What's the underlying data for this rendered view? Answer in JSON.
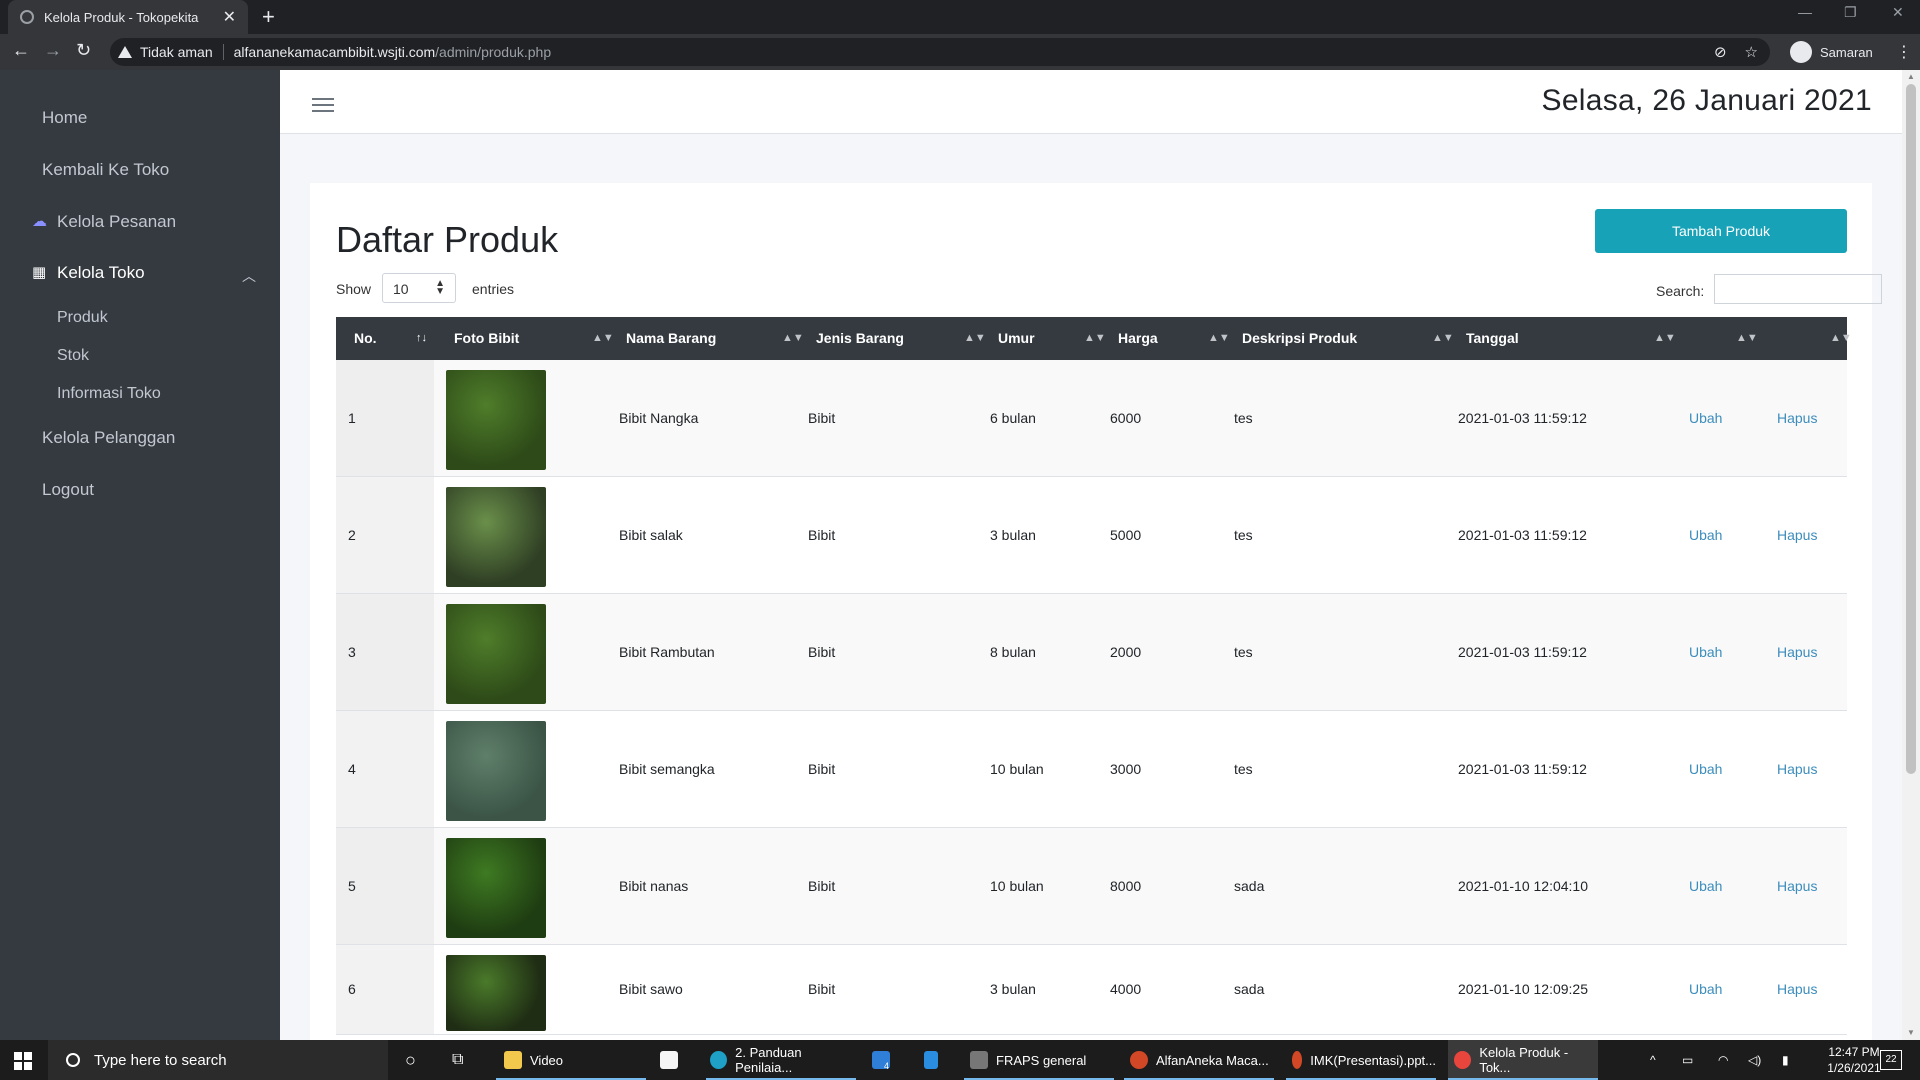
{
  "browser": {
    "tab_title": "Kelola Produk - Tokopekita",
    "security_label": "Tidak aman",
    "url_host": "alfananekamacambibit.wsjti.com",
    "url_path": "/admin/produk.php",
    "profile_name": "Samaran"
  },
  "sidebar": {
    "home": "Home",
    "back_to_store": "Kembali Ke Toko",
    "orders": "Kelola Pesanan",
    "manage_store": "Kelola Toko",
    "sub_items": [
      "Produk",
      "Stok",
      "Informasi Toko"
    ],
    "customers": "Kelola Pelanggan",
    "logout": "Logout"
  },
  "header": {
    "date": "Selasa, 26 Januari 2021"
  },
  "content": {
    "title": "Daftar Produk",
    "add_button": "Tambah Produk",
    "show_label": "Show",
    "entries_value": "10",
    "entries_label": "entries",
    "search_label": "Search:"
  },
  "table": {
    "columns": [
      "No.",
      "Foto Bibit",
      "Nama Barang",
      "Jenis Barang",
      "Umur",
      "Harga",
      "Deskripsi Produk",
      "Tanggal"
    ],
    "rows": [
      {
        "no": "1",
        "nama": "Bibit Nangka",
        "jenis": "Bibit",
        "umur": "6 bulan",
        "harga": "6000",
        "deskripsi": "tes",
        "tanggal": "2021-01-03 11:59:12",
        "edit": "Ubah",
        "delete": "Hapus"
      },
      {
        "no": "2",
        "nama": "Bibit salak",
        "jenis": "Bibit",
        "umur": "3 bulan",
        "harga": "5000",
        "deskripsi": "tes",
        "tanggal": "2021-01-03 11:59:12",
        "edit": "Ubah",
        "delete": "Hapus"
      },
      {
        "no": "3",
        "nama": "Bibit Rambutan",
        "jenis": "Bibit",
        "umur": "8 bulan",
        "harga": "2000",
        "deskripsi": "tes",
        "tanggal": "2021-01-03 11:59:12",
        "edit": "Ubah",
        "delete": "Hapus"
      },
      {
        "no": "4",
        "nama": "Bibit semangka",
        "jenis": "Bibit",
        "umur": "10 bulan",
        "harga": "3000",
        "deskripsi": "tes",
        "tanggal": "2021-01-03 11:59:12",
        "edit": "Ubah",
        "delete": "Hapus"
      },
      {
        "no": "5",
        "nama": "Bibit nanas",
        "jenis": "Bibit",
        "umur": "10 bulan",
        "harga": "8000",
        "deskripsi": "sada",
        "tanggal": "2021-01-10 12:04:10",
        "edit": "Ubah",
        "delete": "Hapus"
      },
      {
        "no": "6",
        "nama": "Bibit sawo",
        "jenis": "Bibit",
        "umur": "3 bulan",
        "harga": "4000",
        "deskripsi": "sada",
        "tanggal": "2021-01-10 12:09:25",
        "edit": "Ubah",
        "delete": "Hapus"
      }
    ]
  },
  "taskbar": {
    "search_placeholder": "Type here to search",
    "items": [
      "Video",
      "2. Panduan Penilaia...",
      "FRAPS general",
      "AlfanAneka Maca...",
      "IMK(Presentasi).ppt...",
      "Kelola Produk - Tok..."
    ],
    "mail_badge": "4",
    "time": "12:47 PM",
    "date": "1/26/2021",
    "notifications": "22"
  },
  "colors": {
    "sidebar": "#343a40",
    "accent": "#17a2b8",
    "link": "#3c8dbc"
  }
}
